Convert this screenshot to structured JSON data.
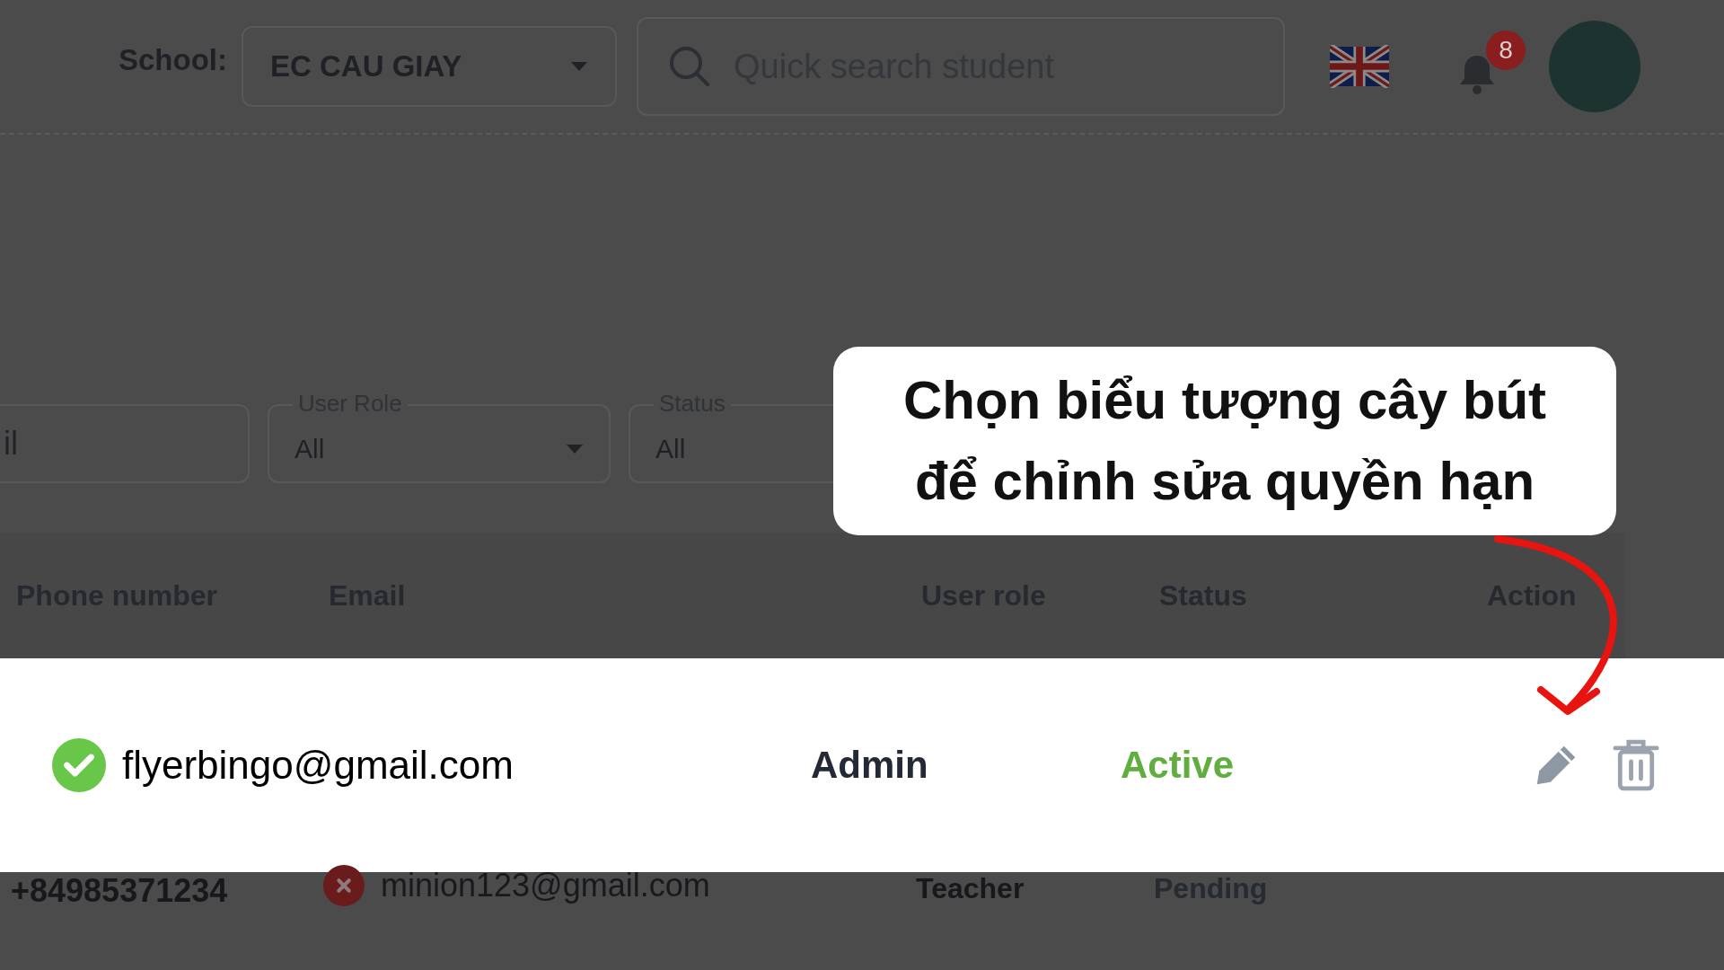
{
  "header": {
    "school_label": "School:",
    "school_value": "EC CAU GIAY",
    "search": {
      "placeholder": "Quick search student"
    },
    "notifications": {
      "count": "8"
    }
  },
  "filters": [
    {
      "kind": "text",
      "placeholder": "il"
    },
    {
      "kind": "select",
      "label": "User Role",
      "value": "All"
    },
    {
      "kind": "select",
      "label": "Status",
      "value": "All"
    }
  ],
  "table": {
    "columns": [
      "Phone number",
      "Email",
      "User role",
      "Status",
      "Action"
    ],
    "rows": [
      {
        "spotlight": true,
        "verified": true,
        "email": "flyerbingo@gmail.com",
        "role": "Admin",
        "status": "Active",
        "color": "#5fae3e"
      },
      {
        "spotlight": false,
        "verified": false,
        "phone": "+84985371234",
        "email": "minion123@gmail.com",
        "role": "Teacher",
        "status": "Pending",
        "color": "#262a31"
      }
    ]
  },
  "callout": {
    "lines": [
      "Chọn biểu tượng cây bút",
      "để chỉnh sửa quyền hạn"
    ]
  }
}
